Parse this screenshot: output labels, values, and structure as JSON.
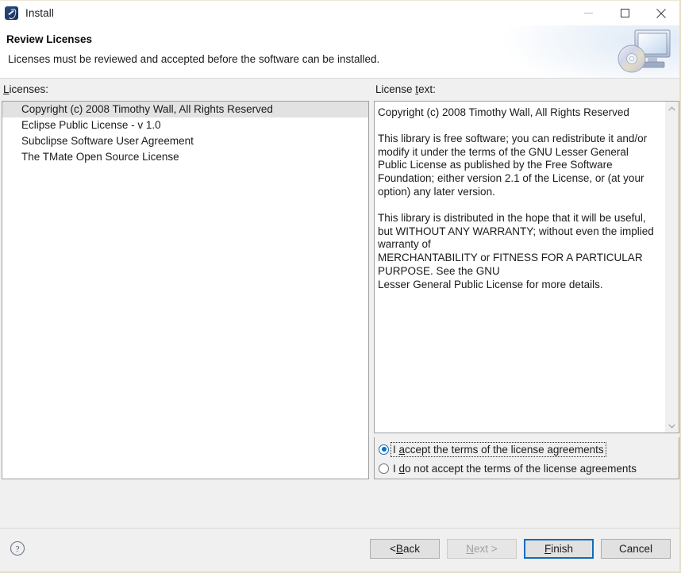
{
  "window": {
    "title": "Install",
    "icon": "eclipse-installer-icon",
    "controls": {
      "minimize": "minimize-icon",
      "maximize": "maximize-icon",
      "close": "close-icon"
    }
  },
  "header": {
    "title": "Review Licenses",
    "subtitle": "Licenses must be reviewed and accepted before the software can be installed.",
    "icon": "monitor-with-disc-icon"
  },
  "licenses_panel": {
    "label_prefix": "L",
    "label_rest": "icenses:",
    "items": [
      "Copyright (c) 2008 Timothy Wall, All Rights Reserved",
      "Eclipse Public License - v 1.0",
      "Subclipse Software User Agreement",
      "The TMate Open Source License"
    ],
    "selected_index": 0
  },
  "license_text_panel": {
    "label_a": "License ",
    "label_mn": "t",
    "label_b": "ext:",
    "paragraphs": [
      "Copyright (c) 2008 Timothy Wall, All Rights Reserved",
      "This library is free software; you can redistribute it and/or modify it under the terms of the GNU Lesser General Public License as published by the Free Software Foundation; either version 2.1 of the License, or (at your option) any later version.",
      "This library is distributed in the hope that it will be useful, but WITHOUT ANY WARRANTY; without even the implied warranty of\nMERCHANTABILITY or FITNESS FOR A PARTICULAR PURPOSE.  See the GNU\nLesser General Public License for more details."
    ],
    "scrollbar": {
      "up_arrow": "chevron-up-icon",
      "down_arrow": "chevron-down-icon"
    }
  },
  "acceptance": {
    "accept": {
      "pre": "I ",
      "mn": "a",
      "post": "ccept the terms of the license agreements",
      "selected": true,
      "focused": true
    },
    "decline": {
      "pre": "I ",
      "mn": "d",
      "post": "o not accept the terms of the license agreements",
      "selected": false,
      "focused": false
    }
  },
  "footer": {
    "help": "help-icon",
    "buttons": [
      {
        "pre": "< ",
        "mn": "B",
        "post": "ack",
        "state": "enabled",
        "name": "back-button"
      },
      {
        "pre": "",
        "mn": "N",
        "post": "ext >",
        "state": "disabled",
        "name": "next-button"
      },
      {
        "pre": "",
        "mn": "F",
        "post": "inish",
        "state": "default",
        "name": "finish-button"
      },
      {
        "pre": "",
        "mn": "",
        "post": "Cancel",
        "state": "enabled",
        "name": "cancel-button"
      }
    ]
  },
  "colors": {
    "accent": "#0f6cbd",
    "selection": "#e2e2e2",
    "panel": "#f0f0f0",
    "border": "#a0a0a0"
  }
}
